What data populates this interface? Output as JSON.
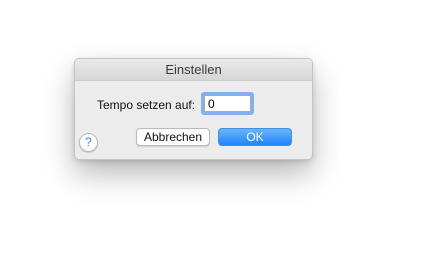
{
  "dialog": {
    "title": "Einstellen",
    "tempo_label": "Tempo setzen auf:",
    "tempo_value": "0",
    "help_symbol": "?",
    "help_icon": "question-mark-icon",
    "cancel_label": "Abbrechen",
    "ok_label": "OK"
  },
  "colors": {
    "accent": "#1e86fb",
    "focus_ring": "#83b1ef"
  }
}
